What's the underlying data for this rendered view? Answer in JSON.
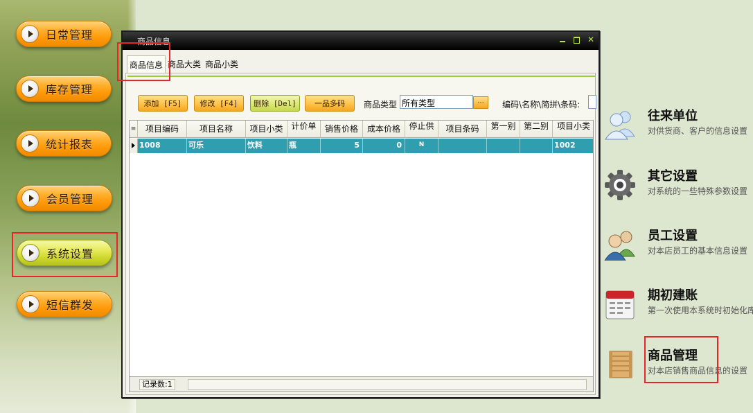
{
  "nav": {
    "items": [
      {
        "label": "日常管理"
      },
      {
        "label": "库存管理"
      },
      {
        "label": "统计报表"
      },
      {
        "label": "会员管理"
      },
      {
        "label": "系统设置"
      },
      {
        "label": "短信群发"
      }
    ],
    "active_label": "系统设置"
  },
  "dialog": {
    "title": "商品信息",
    "tabs": [
      "商品信息",
      "商品大类",
      "商品小类"
    ],
    "active_tab": "商品信息",
    "toolbar": {
      "add": "添加 [F5]",
      "edit": "修改 [F4]",
      "delete": "删除 [Del]",
      "multi_code": "一品多码",
      "category_label": "商品类型",
      "category_value": "所有类型",
      "ellipsis": "...",
      "search_label": "编码\\名称\\简拼\\条码:"
    },
    "grid": {
      "corner": "≡",
      "columns": [
        "项目编码",
        "项目名称",
        "项目小类",
        "计价单",
        "销售价格",
        "成本价格",
        "停止供",
        "项目条码",
        "第一别",
        "第二别",
        "项目小类"
      ],
      "rows": [
        [
          "1008",
          "可乐",
          "饮料",
          "瓶",
          "5",
          "0",
          "N",
          "",
          "",
          "",
          "1002"
        ]
      ]
    },
    "status": {
      "record_count": "记录数:1"
    }
  },
  "right_panel": [
    {
      "title": "往来单位",
      "desc": "对供货商、客户的信息设置",
      "icon": "users-icon"
    },
    {
      "title": "其它设置",
      "desc": "对系统的一些特殊参数设置",
      "icon": "gear-icon"
    },
    {
      "title": "员工设置",
      "desc": "对本店员工的基本信息设置",
      "icon": "staff-icon"
    },
    {
      "title": "期初建账",
      "desc": "第一次使用本系统时初始化库",
      "icon": "calendar-icon"
    },
    {
      "title": "商品管理",
      "desc": "对本店销售商品信息的设置",
      "icon": "crate-icon"
    }
  ]
}
